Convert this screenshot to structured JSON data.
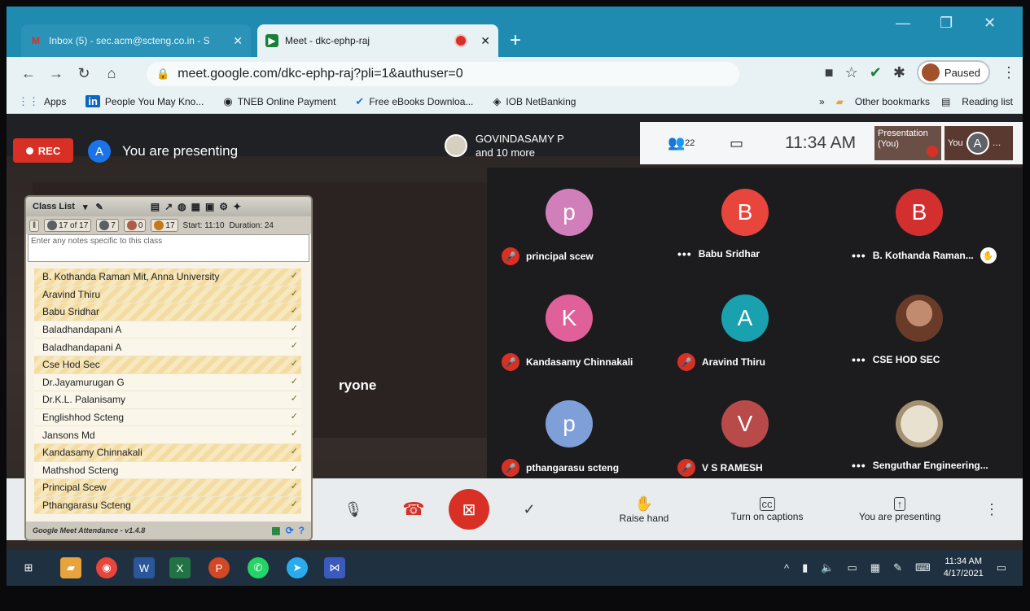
{
  "browser": {
    "tabs": [
      {
        "title": "Inbox (5) - sec.acm@scteng.co.in - S",
        "icon": "gmail-icon",
        "active": false
      },
      {
        "title": "Meet - dkc-ephp-raj",
        "icon": "meet-icon",
        "active": true
      }
    ],
    "url": "meet.google.com/dkc-ephp-raj?pli=1&authuser=0",
    "paused_label": "Paused",
    "bookmarks": [
      {
        "label": "Apps",
        "icon": "apps-grid-icon"
      },
      {
        "label": "People You May Kno...",
        "icon": "linkedin-icon"
      },
      {
        "label": "TNEB Online Payment",
        "icon": "globe-icon"
      },
      {
        "label": "Free eBooks Downloa...",
        "icon": "check-icon"
      },
      {
        "label": "IOB NetBanking",
        "icon": "iob-icon"
      }
    ],
    "bookmarks_overflow": "»",
    "other_bookmarks": "Other bookmarks",
    "reading_list": "Reading list"
  },
  "meet": {
    "rec_label": "REC",
    "presenter_initial": "A",
    "presenting_label": "You are presenting",
    "speaker_name": "GOVINDASAMY P",
    "speaker_more": "and 10 more",
    "people_count": "22",
    "time": "11:34 AM",
    "presentation_thumb": "Presentation (You)",
    "you_label": "You",
    "you_initial": "A",
    "present_text": "ryone",
    "participants": [
      {
        "name": "principal scew",
        "initial": "p",
        "color": "#d07fba",
        "status": "mic-off"
      },
      {
        "name": "Babu Sridhar",
        "initial": "B",
        "color": "#e8453c",
        "status": "more"
      },
      {
        "name": "B. Kothanda Raman...",
        "initial": "B",
        "color": "#d32f2f",
        "status": "more-hand"
      },
      {
        "name": "Kandasamy Chinnakali",
        "initial": "K",
        "color": "#e0609a",
        "status": "mic-off"
      },
      {
        "name": "Aravind Thiru",
        "initial": "A",
        "color": "#1aa1b0",
        "status": "mic-off"
      },
      {
        "name": "CSE HOD SEC",
        "initial": "",
        "color": "#7a4a35",
        "status": "more"
      },
      {
        "name": "pthangarasu scteng",
        "initial": "p",
        "color": "#7f9fd8",
        "status": "mic-off"
      },
      {
        "name": "V S RAMESH",
        "initial": "V",
        "color": "#b84a4a",
        "status": "mic-off"
      },
      {
        "name": "Senguthar Engineering...",
        "initial": "",
        "color": "#d8cdb5",
        "status": "more"
      }
    ],
    "controls": {
      "raise_hand": "Raise hand",
      "captions": "Turn on captions",
      "presenting": "You are presenting"
    }
  },
  "classlist": {
    "title": "Class List",
    "stats": {
      "present": "17 of 17",
      "unknown": "7",
      "absent": "0",
      "total": "17",
      "start": "Start: 11:10",
      "duration": "Duration: 24"
    },
    "notes_placeholder": "Enter any notes specific to this class",
    "students": [
      "B. Kothanda Raman Mit, Anna University",
      "Aravind Thiru",
      "Babu Sridhar",
      "Baladhandapani A",
      "Baladhandapani A",
      "Cse Hod Sec",
      "Dr.Jayamurugan G",
      "Dr.K.L. Palanisamy",
      "Englishhod Scteng",
      "Jansons Md",
      "Kandasamy Chinnakali",
      "Mathshod Scteng",
      "Principal Scew",
      "Pthangarasu Scteng"
    ],
    "footer": "Google Meet Attendance - v1.4.8"
  },
  "taskbar": {
    "time": "11:34 AM",
    "date": "4/17/2021"
  },
  "colors": {
    "tab_bar": "#1f8bb0",
    "rec_red": "#d93025",
    "meet_dark": "#202124"
  }
}
